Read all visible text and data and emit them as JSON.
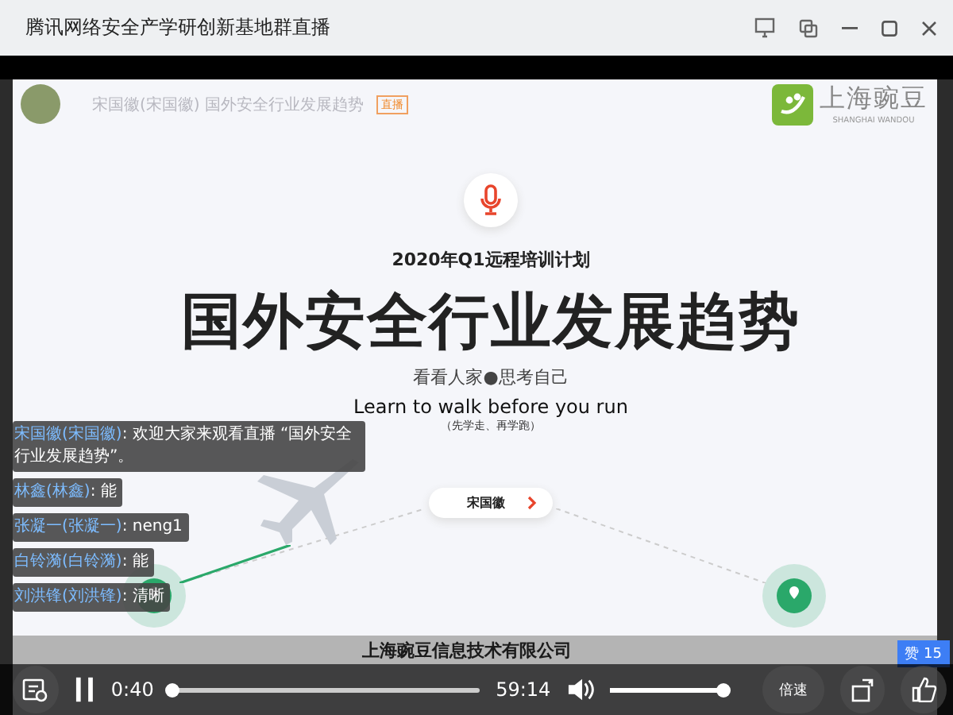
{
  "window": {
    "title": "腾讯网络安全产学研创新基地群直播"
  },
  "slide_header": {
    "speaker": "宋国徽(宋国徽) 国外安全行业发展趋势",
    "badge": "直播",
    "logo_name": "上海豌豆",
    "logo_subtitle": "SHANGHAI WANDOU"
  },
  "slide": {
    "subtitle": "2020年Q1远程培训计划",
    "headline": "国外安全行业发展趋势",
    "tagline": "看看人家●思考自己",
    "motto": "Learn to walk before you run",
    "motto_note": "（先学走、再学跑）",
    "speaker_button": "宋国徽",
    "company": "上海豌豆信息技术有限公司"
  },
  "chat": [
    {
      "name": "宋国徽(宋国徽)",
      "message": ": 欢迎大家来观看直播 “国外安全行业发展趋势”。"
    },
    {
      "name": "林鑫(林鑫)",
      "message": ": 能"
    },
    {
      "name": "张凝一(张凝一)",
      "message": ": neng1"
    },
    {
      "name": "白铃漪(白铃漪)",
      "message": ": 能"
    },
    {
      "name": "刘洪锋(刘洪锋)",
      "message": ": 清晰"
    }
  ],
  "likes": {
    "label": "赞 15"
  },
  "player": {
    "playing": true,
    "elapsed": "0:40",
    "duration": "59:14",
    "progress": {
      "level": 0.01
    },
    "volume": {
      "level": 1.0
    },
    "speed_button": "倍速"
  }
}
